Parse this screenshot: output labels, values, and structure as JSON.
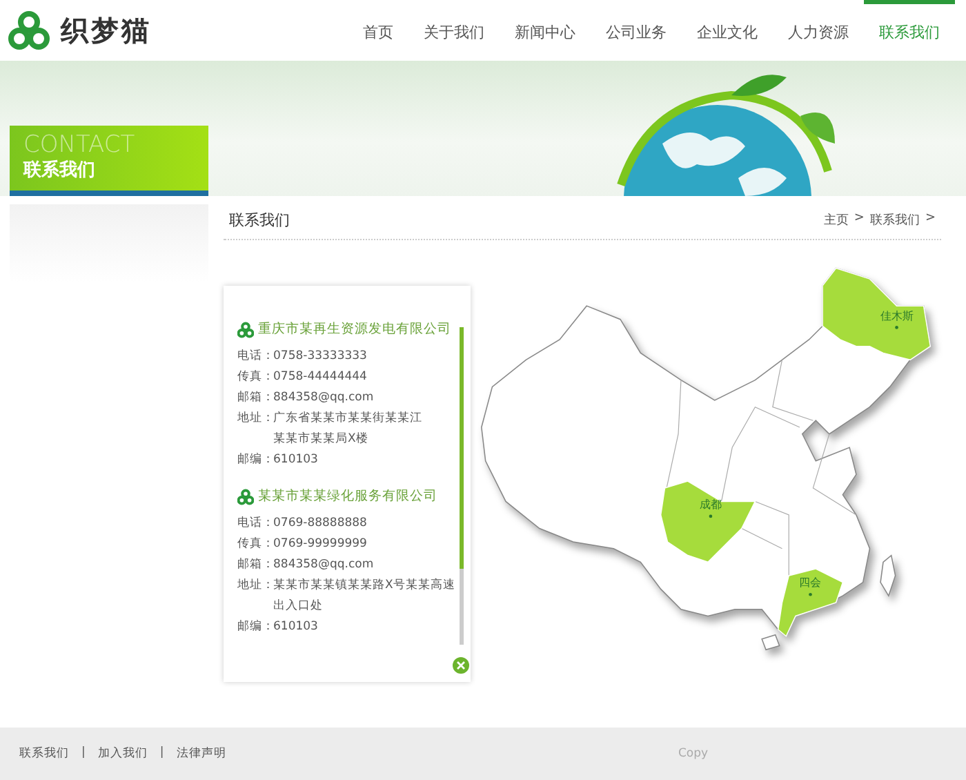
{
  "logo": {
    "text": "织梦猫"
  },
  "nav": [
    {
      "label": "首页",
      "selected": false
    },
    {
      "label": "关于我们",
      "selected": false
    },
    {
      "label": "新闻中心",
      "selected": false
    },
    {
      "label": "公司业务",
      "selected": false
    },
    {
      "label": "企业文化",
      "selected": false
    },
    {
      "label": "人力资源",
      "selected": false
    },
    {
      "label": "联系我们",
      "selected": true
    }
  ],
  "banner": {
    "title_en": "CONTACT",
    "title": "联系我们"
  },
  "content": {
    "title": "联系我们",
    "breadcrumb": [
      "主页",
      "联系我们"
    ],
    "separator": ">"
  },
  "companies": [
    {
      "name": "重庆市某再生资源发电有限公司",
      "fields": [
        {
          "label": "电话：",
          "lines": [
            "0758-33333333"
          ]
        },
        {
          "label": "传真：",
          "lines": [
            "0758-44444444"
          ]
        },
        {
          "label": "邮箱：",
          "lines": [
            "884358@qq.com"
          ]
        },
        {
          "label": "地址：",
          "lines": [
            "广东省某某市某某街某某江",
            "某某市某某局X楼"
          ]
        },
        {
          "label": "邮编：",
          "lines": [
            "610103"
          ]
        }
      ]
    },
    {
      "name": "某某市某某绿化服务有限公司",
      "fields": [
        {
          "label": "电话：",
          "lines": [
            "0769-88888888"
          ]
        },
        {
          "label": "传真：",
          "lines": [
            "0769-99999999"
          ]
        },
        {
          "label": "邮箱：",
          "lines": [
            "884358@qq.com"
          ]
        },
        {
          "label": "地址：",
          "lines": [
            "某某市某某镇某某路X号某某高速",
            "出入口处"
          ]
        },
        {
          "label": "邮编：",
          "lines": [
            "610103"
          ]
        }
      ]
    }
  ],
  "map": {
    "cities": [
      {
        "name": "佳木斯"
      },
      {
        "name": "成都"
      },
      {
        "name": "四会"
      }
    ]
  },
  "footer": {
    "links": [
      "联系我们",
      "加入我们",
      "法律声明"
    ],
    "separator": "|",
    "copyright": "Copy"
  }
}
